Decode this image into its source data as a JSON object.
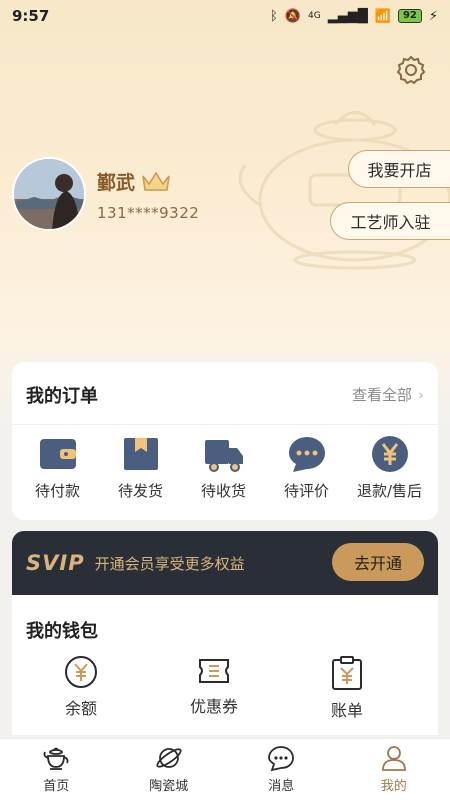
{
  "status_bar": {
    "time": "9:57",
    "signal": "4G",
    "battery": "92"
  },
  "profile": {
    "name": "鄞武",
    "phone": "131****9322",
    "open_shop_label": "我要开店",
    "craftsman_label": "工艺师入驻"
  },
  "orders": {
    "title": "我的订单",
    "view_all": "查看全部",
    "items": [
      {
        "label": "待付款",
        "icon": "wallet-icon"
      },
      {
        "label": "待发货",
        "icon": "box-icon"
      },
      {
        "label": "待收货",
        "icon": "truck-icon"
      },
      {
        "label": "待评价",
        "icon": "chat-icon"
      },
      {
        "label": "退款/售后",
        "icon": "yen-icon"
      }
    ]
  },
  "svip": {
    "logo": "SVIP",
    "text": "开通会员享受更多权益",
    "button": "去开通"
  },
  "wallet": {
    "title": "我的钱包",
    "items": [
      {
        "label": "余额",
        "icon": "yen-circle-icon"
      },
      {
        "label": "优惠券",
        "icon": "coupon-icon"
      },
      {
        "label": "账单",
        "icon": "bill-icon"
      }
    ]
  },
  "nav": {
    "items": [
      {
        "label": "首页",
        "icon": "teapot-icon",
        "active": false
      },
      {
        "label": "陶瓷城",
        "icon": "planet-icon",
        "active": false
      },
      {
        "label": "消息",
        "icon": "message-icon",
        "active": false
      },
      {
        "label": "我的",
        "icon": "user-icon",
        "active": true
      }
    ]
  },
  "colors": {
    "accent": "#a0774a",
    "icon_blue": "#4a5f80",
    "svip_bg": "#2a2e36",
    "svip_gold": "#d9b37b"
  }
}
